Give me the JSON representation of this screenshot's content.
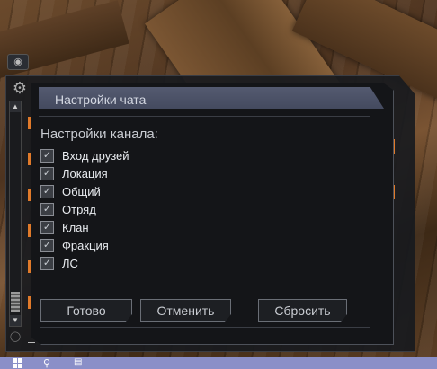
{
  "dialog": {
    "title": "Настройки чата",
    "section_label": "Настройки канала:",
    "channels": [
      {
        "label": "Вход друзей",
        "checked": true
      },
      {
        "label": "Локация",
        "checked": true
      },
      {
        "label": "Общий",
        "checked": true
      },
      {
        "label": "Отряд",
        "checked": true
      },
      {
        "label": "Клан",
        "checked": true
      },
      {
        "label": "Фракция",
        "checked": true
      },
      {
        "label": "ЛС",
        "checked": true
      }
    ],
    "buttons": {
      "ok": "Готово",
      "cancel": "Отменить",
      "reset": "Сбросить"
    }
  },
  "icons": {
    "eye": "eye-icon",
    "gear": "gear-icon",
    "bulb": "bulb-icon",
    "windows": "windows-start-icon",
    "search": "search-icon",
    "task_view": "task-view-icon"
  },
  "colors": {
    "accent": "#e07a2a",
    "title_bar": "#4b5166",
    "dialog_bg": "#141518",
    "taskbar": "#8a8fc8"
  }
}
